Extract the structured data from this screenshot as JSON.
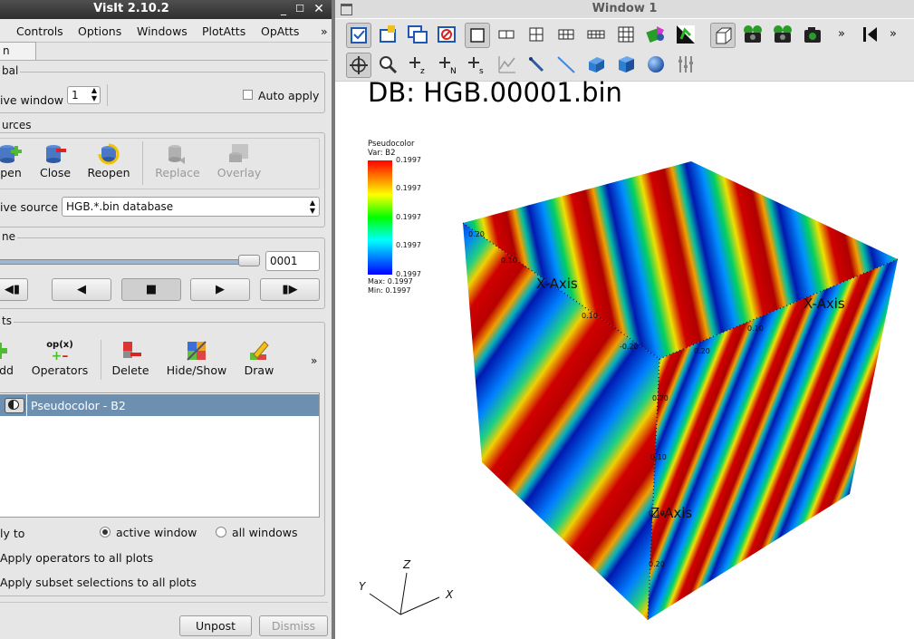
{
  "gui": {
    "title": "VisIt 2.10.2",
    "menu": [
      "Controls",
      "Options",
      "Windows",
      "PlotAtts",
      "OpAtts"
    ],
    "menu_more": "»",
    "tab": "n",
    "global": {
      "group_title": "bal",
      "active_window_label": "ive window",
      "active_window_value": "1",
      "auto_apply_label": "Auto apply",
      "auto_apply_checked": false
    },
    "sources": {
      "group_title": "urces",
      "buttons": [
        {
          "label": "pen",
          "icon": "open-icon",
          "enabled": true
        },
        {
          "label": "Close",
          "icon": "close-database-icon",
          "enabled": true
        },
        {
          "label": "Reopen",
          "icon": "reopen-icon",
          "enabled": true
        },
        {
          "label": "Replace",
          "icon": "replace-icon",
          "enabled": false
        },
        {
          "label": "Overlay",
          "icon": "overlay-icon",
          "enabled": false
        }
      ],
      "active_source_label": "ive source",
      "active_source_value": "HGB.*.bin database"
    },
    "time": {
      "group_title": "ne",
      "timestep_value": "0001",
      "vcr": [
        "◀▮",
        "◀",
        "■",
        "▶",
        "▮▶"
      ]
    },
    "plots": {
      "group_title": "ts",
      "buttons": [
        {
          "label": "dd",
          "icon": "add-plot-icon",
          "has_menu": true
        },
        {
          "label": "Operators",
          "icon": "operators-icon",
          "icon_text": "op(x)",
          "has_menu": true
        },
        {
          "label": "Delete",
          "icon": "delete-plot-icon"
        },
        {
          "label": "Hide/Show",
          "icon": "hide-show-icon"
        },
        {
          "label": "Draw",
          "icon": "draw-icon"
        }
      ],
      "more": "»",
      "plot_list": [
        "Pseudocolor - B2"
      ],
      "apply_to_label": "ly to",
      "apply_active_window": "active window",
      "apply_all_windows": "all windows",
      "apply_operators": "Apply operators to all plots",
      "apply_subsets": "Apply subset selections to all plots"
    },
    "unpost": "Unpost",
    "dismiss": "Dismiss"
  },
  "viewer": {
    "title": "Window 1",
    "db_title": "DB: HGB.00001.bin",
    "legend": {
      "plot": "Pseudocolor",
      "var": "Var: B2",
      "ticks": [
        "0.1997",
        "0.1997",
        "0.1997",
        "0.1997",
        "0.1997"
      ],
      "max": "Max:  0.1997",
      "min": "Min:  0.1997"
    },
    "axis_labels": {
      "x1": "X-Axis",
      "x2": "X-Axis",
      "z": "Z-Axis"
    },
    "tick_labels": {
      "top_left": "0.20",
      "top_mid": "0.10",
      "mid_left": "0.10",
      "corner": "-0.20",
      "right_a": "0.10",
      "right_b": "0.20",
      "z_a": "0.20",
      "z_b": "0.10",
      "z_c": "0.10",
      "z_d": "0.20"
    },
    "triad": {
      "x": "X",
      "y": "Y",
      "z": "Z"
    },
    "more": "»"
  }
}
